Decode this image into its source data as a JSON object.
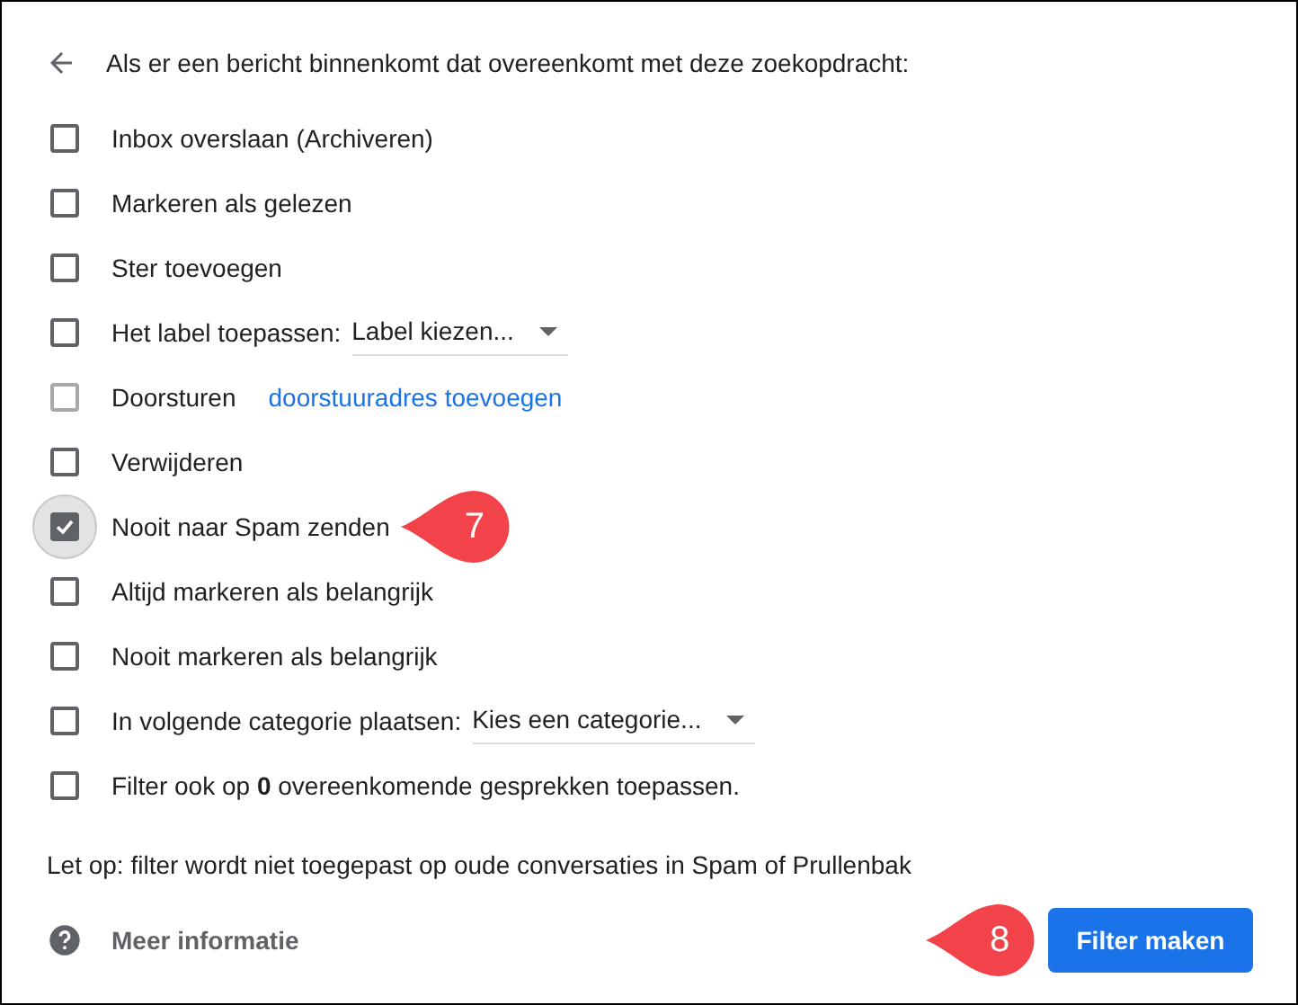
{
  "header": {
    "title": "Als er een bericht binnenkomt dat overeenkomt met deze zoekopdracht:"
  },
  "options": [
    {
      "kind": "plain",
      "label": "Inbox overslaan (Archiveren)",
      "checked": false,
      "disabled": false,
      "focused": false
    },
    {
      "kind": "plain",
      "label": "Markeren als gelezen",
      "checked": false,
      "disabled": false,
      "focused": false
    },
    {
      "kind": "plain",
      "label": "Ster toevoegen",
      "checked": false,
      "disabled": false,
      "focused": false
    },
    {
      "kind": "select",
      "label": "Het label toepassen:",
      "select": "Label kiezen...",
      "checked": false,
      "disabled": false,
      "focused": false
    },
    {
      "kind": "link",
      "label": "Doorsturen",
      "link": "doorstuuradres toevoegen",
      "checked": false,
      "disabled": true,
      "focused": false
    },
    {
      "kind": "plain",
      "label": "Verwijderen",
      "checked": false,
      "disabled": false,
      "focused": false
    },
    {
      "kind": "plain",
      "label": "Nooit naar Spam zenden",
      "checked": true,
      "disabled": false,
      "focused": true,
      "callout": "7"
    },
    {
      "kind": "plain",
      "label": "Altijd markeren als belangrijk",
      "checked": false,
      "disabled": false,
      "focused": false
    },
    {
      "kind": "plain",
      "label": "Nooit markeren als belangrijk",
      "checked": false,
      "disabled": false,
      "focused": false
    },
    {
      "kind": "select",
      "label": "In volgende categorie plaatsen:",
      "select": "Kies een categorie...",
      "checked": false,
      "disabled": false,
      "focused": false
    },
    {
      "kind": "plain",
      "label": "Filter ook op **0** overeenkomende gesprekken toepassen.",
      "checked": false,
      "disabled": false,
      "focused": false
    }
  ],
  "note": "Let op: filter wordt niet toegepast op oude conversaties in Spam of Prullenbak",
  "footer": {
    "help": "Meer informatie",
    "button": "Filter maken",
    "callout": "8"
  }
}
